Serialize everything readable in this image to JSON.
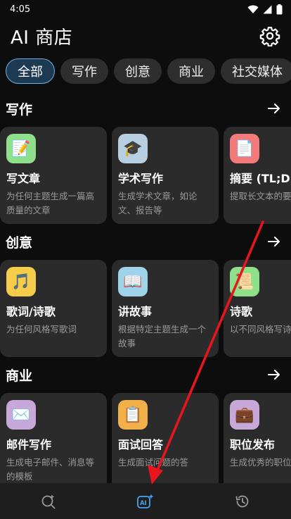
{
  "status": {
    "time": "4:05"
  },
  "header": {
    "title": "AI 商店"
  },
  "chips": [
    "全部",
    "写作",
    "创意",
    "商业",
    "社交媒体"
  ],
  "sections": [
    {
      "title": "写作",
      "cards": [
        {
          "title": "写文章",
          "desc": "为任何主题生成一篇高质量的文章",
          "icon": "📝",
          "bg": "#8fe08a"
        },
        {
          "title": "学术写作",
          "desc": "生成学术文章，如论文、报告等",
          "icon": "🎓",
          "bg": "#b7cfe0"
        },
        {
          "title": "摘要 (TL;DR",
          "desc": "提取长文本的要",
          "icon": "📄",
          "bg": "#f27a7a"
        }
      ]
    },
    {
      "title": "创意",
      "cards": [
        {
          "title": "歌词/诗歌",
          "desc": "为任何风格写歌词",
          "icon": "🎵",
          "bg": "#f7cc4a"
        },
        {
          "title": "讲故事",
          "desc": "根据特定主题生成一个故事",
          "icon": "📖",
          "bg": "#9fd3ea"
        },
        {
          "title": "诗歌",
          "desc": "以不同风格写诗",
          "icon": "📜",
          "bg": "#8fe08a"
        }
      ]
    },
    {
      "title": "商业",
      "cards": [
        {
          "title": "邮件写作",
          "desc": "生成电子邮件、消息等的模板",
          "icon": "✉️",
          "bg": "#c7a8d8"
        },
        {
          "title": "面试回答",
          "desc": "生成面试问题的答",
          "icon": "📋",
          "bg": "#f2b04a"
        },
        {
          "title": "职位发布",
          "desc": "生成优秀的职位",
          "icon": "💼",
          "bg": "#c7a8d8"
        }
      ]
    }
  ],
  "nav": {
    "explore": "search-sparkle-icon",
    "ai": "AI",
    "history": "history-icon"
  },
  "colors": {
    "accent": "#4aa3f0",
    "annotation": "#e8141e"
  }
}
